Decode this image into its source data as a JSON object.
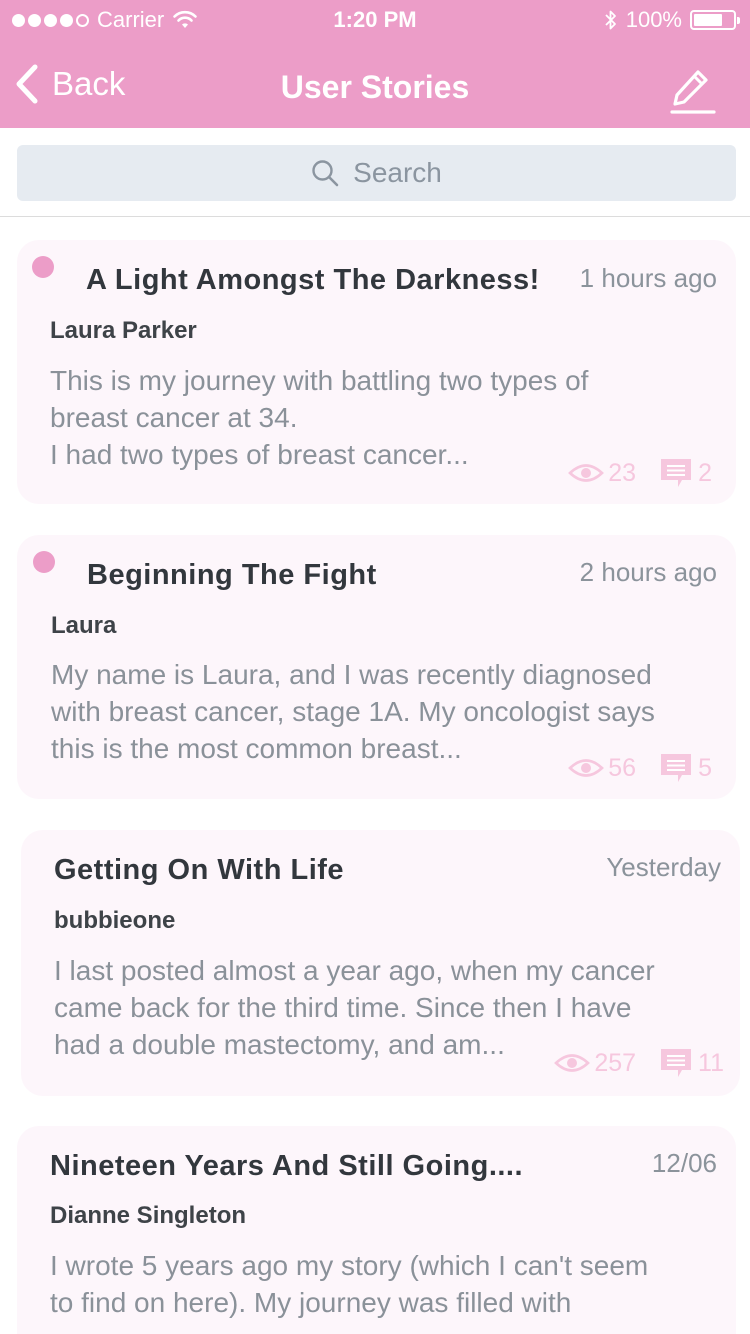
{
  "status_bar": {
    "carrier": "Carrier",
    "time": "1:20 PM",
    "battery": "100%"
  },
  "nav": {
    "back_label": "Back",
    "title": "User Stories"
  },
  "search": {
    "placeholder": "Search"
  },
  "stories": [
    {
      "title": "A Light Amongst The Darkness!",
      "time": "1 hours ago",
      "author": "Laura Parker",
      "excerpt": "This is my journey with battling two types of\nbreast cancer at 34.\nI had two types of breast cancer...",
      "views": "23",
      "comments": "2",
      "unread": true
    },
    {
      "title": "Beginning The Fight",
      "time": "2 hours ago",
      "author": "Laura",
      "excerpt": "My name is Laura, and I was recently diagnosed\nwith breast cancer, stage 1A. My oncologist says\nthis is the most common breast...",
      "views": "56",
      "comments": "5",
      "unread": true
    },
    {
      "title": "Getting On With Life",
      "time": "Yesterday",
      "author": "bubbieone",
      "excerpt": "I last posted almost a year ago, when my cancer\ncame back for the third time. Since then I have\nhad a double mastectomy, and am...",
      "views": "257",
      "comments": "11",
      "unread": false
    },
    {
      "title": "Nineteen Years And Still Going....",
      "time": "12/06",
      "author": "Dianne Singleton",
      "excerpt": "I wrote 5 years ago my story (which I can't seem\nto find on here). My journey was filled with",
      "unread": false
    }
  ],
  "colors": {
    "accent": "#ec9dc8",
    "card_bg": "#fdf6fb",
    "stat": "#f6c7de"
  }
}
